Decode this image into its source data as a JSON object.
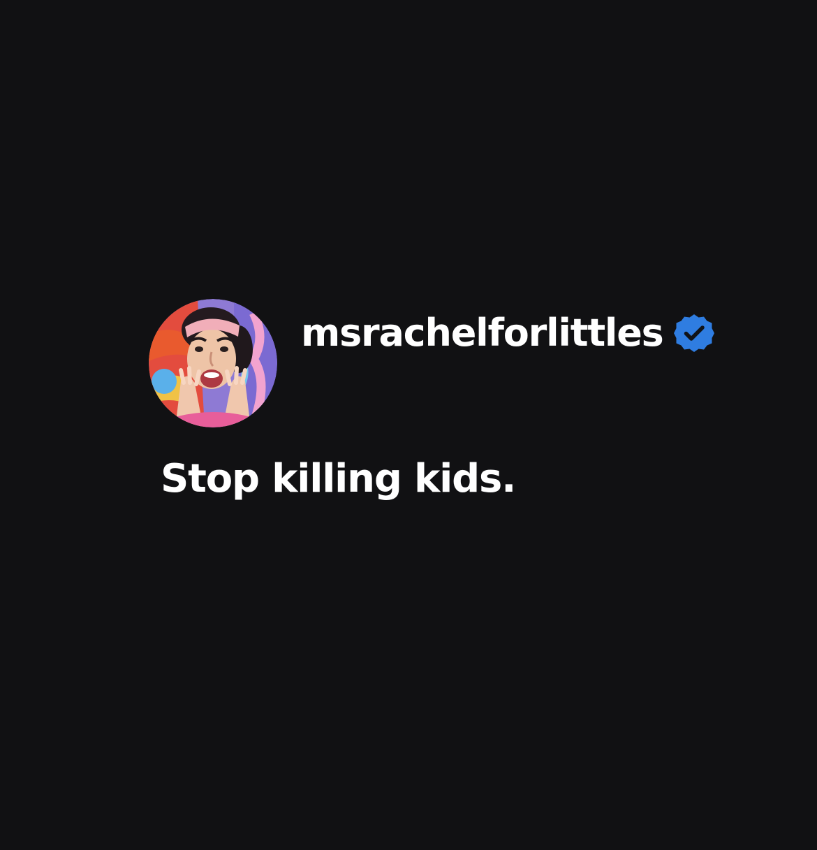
{
  "post": {
    "username": "msrachelforlittles",
    "verified": true,
    "verified_badge_icon": "verified-badge-icon",
    "avatar_icon": "profile-photo",
    "text": "Stop killing kids."
  },
  "colors": {
    "background": "#111113",
    "text": "#ffffff",
    "verified_blue": "#2f7de1"
  }
}
